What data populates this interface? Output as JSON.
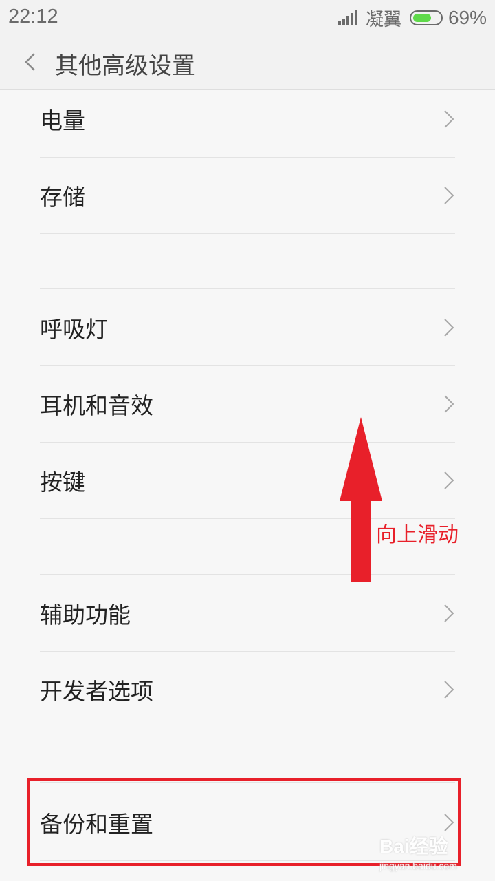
{
  "status_bar": {
    "time": "22:12",
    "carrier": "凝翼",
    "battery_percent": "69%",
    "battery_level": 0.69,
    "battery_color": "#5fd94a"
  },
  "header": {
    "back_icon": "chevron-left-icon",
    "title": "其他高级设置"
  },
  "settings": {
    "group1": [
      "电量",
      "存储"
    ],
    "group2": [
      "呼吸灯",
      "耳机和音效",
      "按键"
    ],
    "group3": [
      "辅助功能",
      "开发者选项"
    ],
    "group4": [
      "备份和重置"
    ]
  },
  "annotation": {
    "swipe_text": "向上滑动",
    "arrow_color": "#e8202a"
  },
  "watermark": {
    "brand": "Bai经验",
    "url": "jingyan.baidu.com"
  }
}
